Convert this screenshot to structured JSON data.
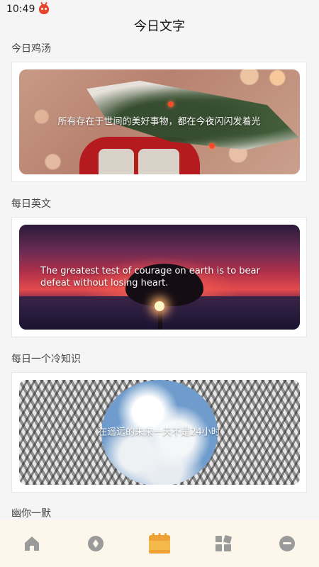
{
  "status": {
    "time": "10:49"
  },
  "page": {
    "title": "今日文字"
  },
  "sections": [
    {
      "label": "今日鸡汤",
      "text": "所有存在于世间的美好事物，都在今夜闪闪发着光"
    },
    {
      "label": "每日英文",
      "text": "The greatest test of courage on earth is to bear defeat without losing heart."
    },
    {
      "label": "每日一个冷知识",
      "text": "在遥远的未来一天不是24小时"
    },
    {
      "label": "幽你一默"
    }
  ],
  "nav": {
    "items": [
      {
        "icon": "home-icon",
        "active": false
      },
      {
        "icon": "compass-icon",
        "active": false
      },
      {
        "icon": "calendar-icon",
        "active": true
      },
      {
        "icon": "grid-icon",
        "active": false
      },
      {
        "icon": "profile-icon",
        "active": false
      }
    ]
  },
  "colors": {
    "accent": "#f5b84a",
    "inactive": "#9a9a9a",
    "nav_bg": "#fdf6ea"
  }
}
